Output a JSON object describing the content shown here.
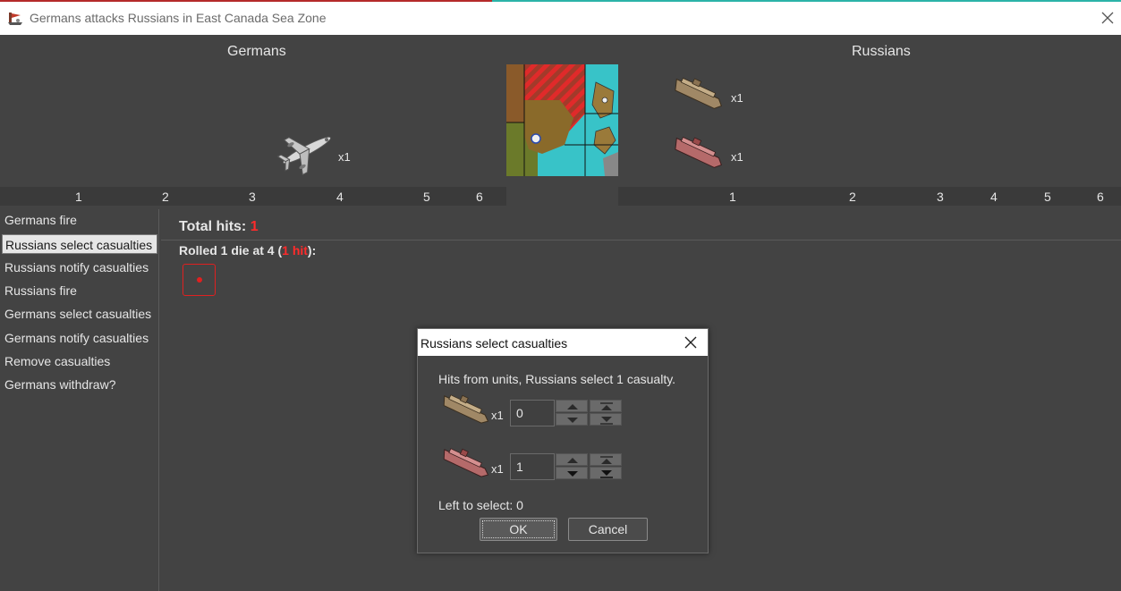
{
  "window": {
    "title": "Germans attacks Russians in East Canada Sea Zone"
  },
  "attacker": {
    "name": "Germans",
    "units": [
      {
        "icon": "bomber-plane-icon",
        "count": "x1"
      }
    ]
  },
  "defender": {
    "name": "Russians",
    "units": [
      {
        "icon": "transport-ship-tan-icon",
        "count": "x1"
      },
      {
        "icon": "transport-ship-red-icon",
        "count": "x1"
      }
    ]
  },
  "dice_rows": {
    "attacker": [
      "1",
      "2",
      "3",
      "4",
      "5",
      "6"
    ],
    "defender": [
      "1",
      "2",
      "3",
      "4",
      "5",
      "6"
    ]
  },
  "steps": [
    {
      "label": "Germans fire",
      "selected": false
    },
    {
      "label": "Russians select casualties",
      "selected": true
    },
    {
      "label": "Russians notify casualties",
      "selected": false
    },
    {
      "label": "Russians fire",
      "selected": false
    },
    {
      "label": "Germans select casualties",
      "selected": false
    },
    {
      "label": "Germans notify casualties",
      "selected": false
    },
    {
      "label": "Remove casualties",
      "selected": false
    },
    {
      "label": "Germans withdraw?",
      "selected": false
    }
  ],
  "results": {
    "total_hits_label": "Total hits:",
    "total_hits_value": "1",
    "rolled_prefix": "Rolled 1 die at 4 (",
    "rolled_hits": "1 hit",
    "rolled_suffix": "):",
    "dice_value": 1
  },
  "dialog": {
    "title": "Russians select casualties",
    "message": "Hits from units,  Russians select 1 casualty.",
    "rows": [
      {
        "icon": "transport-ship-tan-icon",
        "count": "x1",
        "value": "0"
      },
      {
        "icon": "transport-ship-red-icon",
        "count": "x1",
        "value": "1"
      }
    ],
    "left_to_select": "Left to select: 0",
    "ok_label": "OK",
    "cancel_label": "Cancel"
  },
  "colors": {
    "background": "#434343",
    "hit_red": "#ff2b2b",
    "text": "#e6e6e6"
  }
}
